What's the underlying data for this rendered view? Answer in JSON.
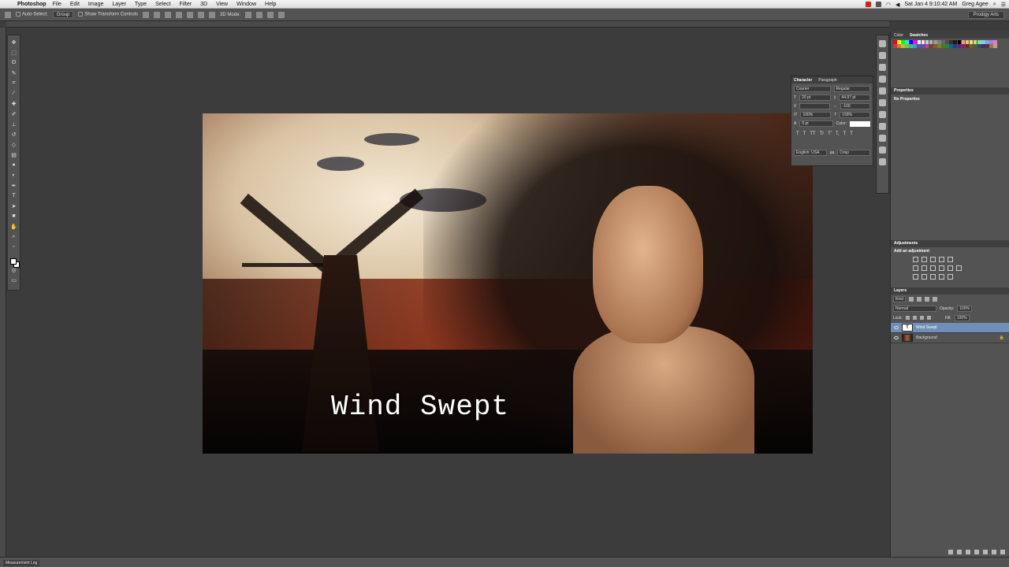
{
  "menubar": {
    "app": "Photoshop",
    "items": [
      "File",
      "Edit",
      "Image",
      "Layer",
      "Type",
      "Select",
      "Filter",
      "3D",
      "View",
      "Window",
      "Help"
    ],
    "clock": "Sat Jan 4  9:10:42 AM",
    "user": "Greg Agee"
  },
  "options_bar": {
    "auto_select_label": "Auto-Select:",
    "auto_select_value": "Group",
    "transform_label": "Show Transform Controls",
    "mode_label": "3D Mode:",
    "workspace": "Prodigy Arts"
  },
  "canvas": {
    "caption": "Wind Swept"
  },
  "character_panel": {
    "tabs": [
      "Character",
      "Paragraph"
    ],
    "font_family": "Courier",
    "font_style": "Regular",
    "font_size": "20 pt",
    "leading": "44.97 pt",
    "tracking": "-100",
    "vertical_scale": "100%",
    "horizontal_scale": "158%",
    "baseline_shift": "0 pt",
    "color_label": "Color:",
    "language": "English: USA",
    "antialias": "Crisp",
    "style_buttons": [
      "T",
      "T",
      "TT",
      "Tr",
      "T'",
      "T,",
      "T",
      "T"
    ]
  },
  "swatches_panel": {
    "tabs": [
      "Color",
      "Swatches"
    ],
    "colors": [
      "#ff0000",
      "#ffff00",
      "#00ff00",
      "#00ffff",
      "#0000ff",
      "#ff00ff",
      "#ffffff",
      "#e6e6e6",
      "#cccccc",
      "#b3b3b3",
      "#999999",
      "#808080",
      "#666666",
      "#4d4d4d",
      "#333333",
      "#1a1a1a",
      "#000000",
      "#f0a080",
      "#f0c080",
      "#f0e080",
      "#c0e080",
      "#80e0a0",
      "#80d0e0",
      "#80a0e0",
      "#a080e0",
      "#e080c0",
      "#c04040",
      "#c08040",
      "#c0c040",
      "#80c040",
      "#40c080",
      "#40a0c0",
      "#4060c0",
      "#8040c0",
      "#c040a0",
      "#804020",
      "#806020",
      "#808020",
      "#408020",
      "#208060",
      "#206080",
      "#204080",
      "#602080",
      "#802060",
      "#603018",
      "#706030",
      "#506030",
      "#305060",
      "#403060",
      "#603040",
      "#a07050",
      "#c0a080"
    ]
  },
  "properties_panel": {
    "title": "Properties",
    "content": "No Properties"
  },
  "adjustments_panel": {
    "title": "Adjustments",
    "prompt": "Add an adjustment"
  },
  "layers_panel": {
    "title": "Layers",
    "kind_label": "Kind",
    "blend_mode": "Normal",
    "opacity_label": "Opacity:",
    "opacity": "100%",
    "lock_label": "Lock:",
    "fill_label": "Fill:",
    "fill": "100%",
    "layers": [
      {
        "name": "Wind Swept",
        "type": "text",
        "selected": true
      },
      {
        "name": "Background",
        "type": "image",
        "selected": false
      }
    ]
  },
  "bottom_bar": {
    "tab": "Measurement Log"
  },
  "tools": [
    "move-tool",
    "marquee-tool",
    "lasso-tool",
    "quick-select-tool",
    "crop-tool",
    "eyedropper-tool",
    "healing-brush-tool",
    "brush-tool",
    "clone-stamp-tool",
    "history-brush-tool",
    "eraser-tool",
    "gradient-tool",
    "blur-tool",
    "dodge-tool",
    "pen-tool",
    "type-tool",
    "path-select-tool",
    "shape-tool",
    "hand-tool",
    "zoom-tool"
  ]
}
